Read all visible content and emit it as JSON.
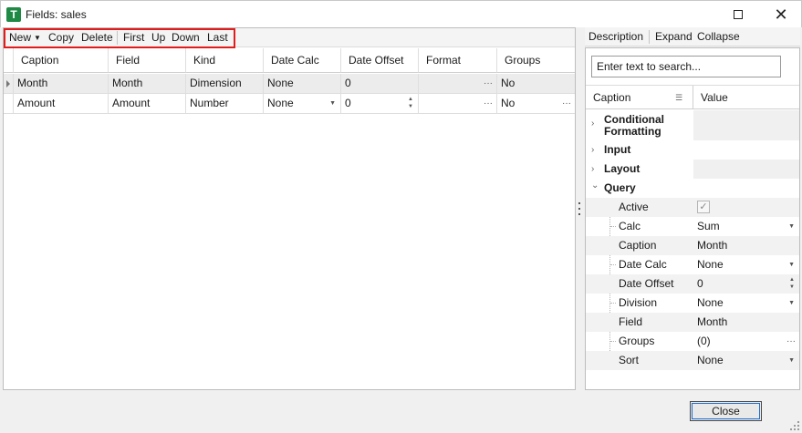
{
  "window": {
    "title": "Fields: sales",
    "icon_letter": "T",
    "maximize_icon": "maximize-icon",
    "close_glyph": "✕"
  },
  "toolbar": {
    "new_label": "New",
    "new_arrow": "▼",
    "copy_label": "Copy",
    "delete_label": "Delete",
    "first_label": "First",
    "up_label": "Up",
    "down_label": "Down",
    "last_label": "Last"
  },
  "grid": {
    "columns": [
      "Caption",
      "Field",
      "Kind",
      "Date Calc",
      "Date Offset",
      "Format",
      "Groups"
    ],
    "rows": [
      {
        "caption": "Month",
        "field": "Month",
        "kind": "Dimension",
        "date_calc": "None",
        "date_offset": "0",
        "format": "",
        "groups": "No",
        "selected": true
      },
      {
        "caption": "Amount",
        "field": "Amount",
        "kind": "Number",
        "date_calc": "None",
        "date_offset": "0",
        "format": "",
        "groups": "No",
        "selected": false
      }
    ],
    "ellipsis": "···",
    "dropdown_glyph": "▼",
    "spin_glyph": "▲▼"
  },
  "properties": {
    "toolbar": {
      "description_label": "Description",
      "expand_label": "Expand",
      "collapse_label": "Collapse"
    },
    "search_placeholder": "Enter text to search...",
    "header": {
      "caption": "Caption",
      "value": "Value"
    },
    "categories": [
      {
        "label": "Conditional Formatting",
        "expanded": false
      },
      {
        "label": "Input",
        "expanded": false
      },
      {
        "label": "Layout",
        "expanded": false
      },
      {
        "label": "Query",
        "expanded": true
      }
    ],
    "query_items": [
      {
        "caption": "Active",
        "value": "",
        "checked": true
      },
      {
        "caption": "Calc",
        "value": "Sum",
        "editor": "dropdown"
      },
      {
        "caption": "Caption",
        "value": "Month"
      },
      {
        "caption": "Date Calc",
        "value": "None",
        "editor": "dropdown"
      },
      {
        "caption": "Date Offset",
        "value": "0",
        "editor": "spin"
      },
      {
        "caption": "Division",
        "value": "None",
        "editor": "dropdown"
      },
      {
        "caption": "Field",
        "value": "Month"
      },
      {
        "caption": "Groups",
        "value": "(0)",
        "editor": "ellipsis"
      },
      {
        "caption": "Sort",
        "value": "None",
        "editor": "dropdown"
      }
    ],
    "chevron_collapsed": "›",
    "chevron_expanded": "⌄",
    "check_glyph": "✓"
  },
  "footer": {
    "close_label": "Close"
  },
  "colors": {
    "app_icon": "#1e8a45",
    "highlight_border": "#e01c1c",
    "focus_outline": "#1f6fd0"
  }
}
